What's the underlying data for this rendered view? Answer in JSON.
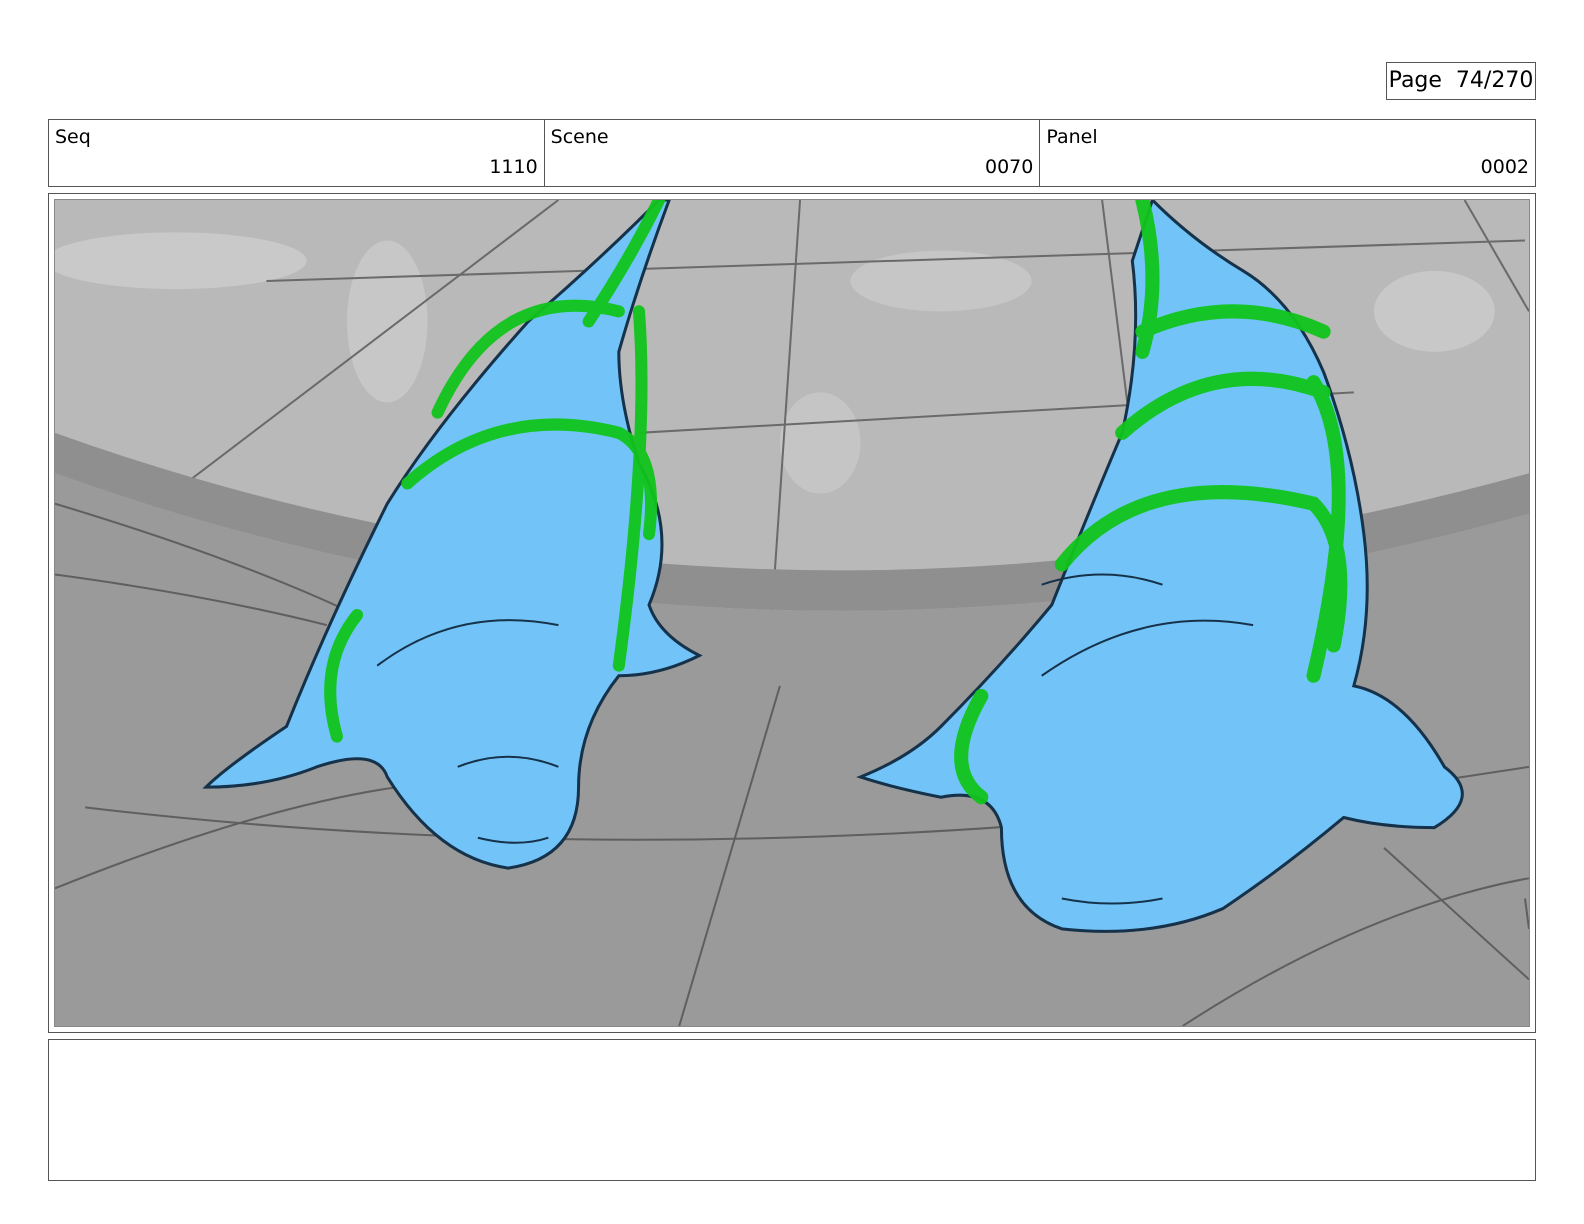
{
  "page": {
    "label": "Page",
    "number": "74/270",
    "text": "Page  74/270"
  },
  "header": {
    "seq": {
      "label": "Seq",
      "value": "1110"
    },
    "scene": {
      "label": "Scene",
      "value": "0070"
    },
    "panel": {
      "label": "Panel",
      "value": "0002"
    }
  },
  "panel_image": {
    "subject": "two light-blue seal figures on grey tiled floor with green action lines",
    "colors": {
      "background": "#a0a0a0",
      "wall": "#bdbdbd",
      "floor": "#9a9a9a",
      "figure_fill": "#72c4f8",
      "figure_outline": "#16324a",
      "action_lines": "#11c41c"
    }
  },
  "notes": {
    "text": ""
  }
}
